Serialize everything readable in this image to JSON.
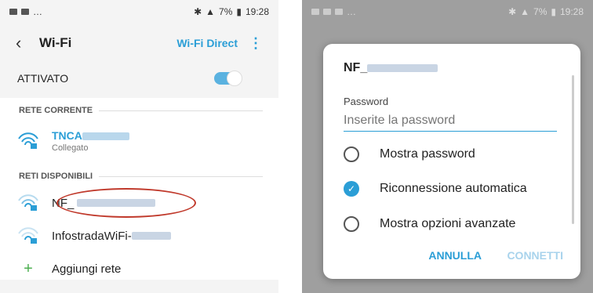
{
  "left": {
    "status_time": "19:28",
    "status_battery": "7%",
    "status_left": "…",
    "title": "Wi-Fi",
    "wifi_direct": "Wi-Fi Direct",
    "toggle_label": "ATTIVATO",
    "current_section": "RETE CORRENTE",
    "current_network": {
      "name": "TNCA",
      "status": "Collegato"
    },
    "available_section": "RETI DISPONIBILI",
    "available_networks": [
      {
        "name": "NF_"
      },
      {
        "name": "InfostradaWiFi-"
      }
    ],
    "add_network": "Aggiungi rete",
    "accent": "#2b9ed6",
    "highlight": "#c0392b"
  },
  "right": {
    "status_time": "19:28",
    "status_battery": "7%",
    "status_left": "…",
    "dialog": {
      "ssid": "NF_",
      "password_label": "Password",
      "password_placeholder": "Inserite la password",
      "options": [
        {
          "label": "Mostra password",
          "checked": false
        },
        {
          "label": "Riconnessione automatica",
          "checked": true
        },
        {
          "label": "Mostra opzioni avanzate",
          "checked": false
        }
      ],
      "cancel": "ANNULLA",
      "connect": "CONNETTI"
    }
  }
}
